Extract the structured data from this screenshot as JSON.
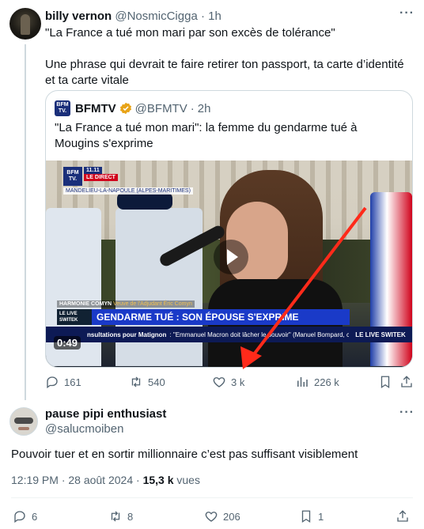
{
  "tweet": {
    "author_name": "billy vernon",
    "author_handle": "@NosmicCigga",
    "separator": "·",
    "time": "1h",
    "text_line1": "\"La France a tué mon mari par son excès de tolérance\"",
    "text_line2": "Une phrase qui devrait te faire retirer ton passport, ta carte d’identité et ta carte vitale",
    "quote": {
      "author_name": "BFMTV",
      "author_handle": "@BFMTV",
      "time": "2h",
      "text": "\"La France a tué mon mari\": la femme du gendarme tué à Mougins s'exprime",
      "video": {
        "duration": "0:49",
        "channel_logo_line1": "BFM",
        "channel_logo_line2": "TV.",
        "clock": "11.11",
        "live_label": "LE DIRECT",
        "location": "MANDELIEU-LA-NAPOULE (ALPES-MARITIMES)",
        "speaker_name": "HARMONIE COMYN",
        "speaker_role": "Veuve de l'Adjudant Éric Comyn",
        "live_switch": "LE LIVE SWITEK",
        "headline": "GENDARME TUÉ : SON ÉPOUSE S'EXPRIME",
        "ticker_prefix": "nsultations pour Matignon",
        "ticker_text": ": \"Emmanuel Macron doit lâcher le pouvoir\" (Manuel Bompard, coordinateur de LFI/BFM",
        "brand_right": "LE LIVE SWITEK"
      },
      "logo_text_line1": "BFM",
      "logo_text_line2": "TV."
    },
    "actions": {
      "replies": "161",
      "reposts": "540",
      "likes": "3 k",
      "views": "226 k"
    }
  },
  "reply": {
    "author_name": "pause pipi enthusiast",
    "author_handle": "@salucmoiben",
    "text": "Pouvoir tuer et en sortir millionnaire c’est pas suffisant visiblement",
    "time": "12:19 PM · 28 août 2024 ·",
    "views_count": "15,3 k",
    "views_label": "vues",
    "actions": {
      "replies": "6",
      "reposts": "8",
      "likes": "206",
      "bookmarks": "1"
    }
  },
  "colors": {
    "text": "#0f1419",
    "secondary": "#536471",
    "border": "#cfd9de",
    "verified_gold": "#e8a317",
    "annotation_arrow": "#ff2a1a"
  },
  "icons": {
    "more": "more-icon",
    "reply": "reply-icon",
    "repost": "repost-icon",
    "like": "heart-icon",
    "views": "views-icon",
    "bookmark": "bookmark-icon",
    "share": "share-icon",
    "verified": "verified-badge-icon",
    "play": "play-icon"
  }
}
